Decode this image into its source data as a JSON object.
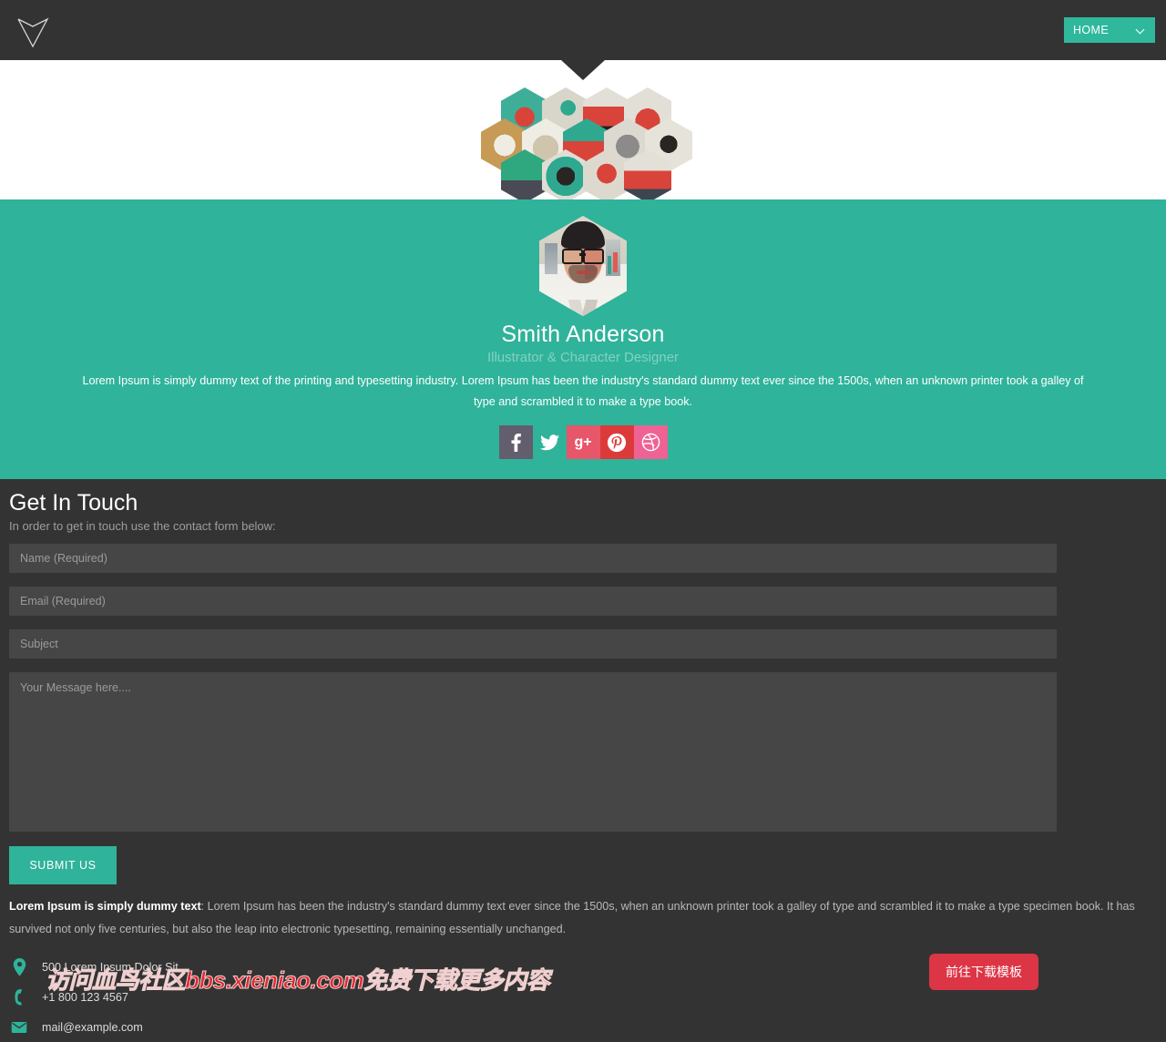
{
  "header": {
    "logo_icon": "chevron-down-logo",
    "nav": {
      "selected": "HOME",
      "options": [
        "HOME"
      ],
      "chevron_icon": "chevron-down-icon",
      "bg_color": "#2fb89c"
    }
  },
  "portfolio": {
    "hexagons": [
      {
        "id": "hex-1",
        "alt": "red character illustration on teal"
      },
      {
        "id": "hex-2",
        "alt": "teal creature illustration on beige"
      },
      {
        "id": "hex-3",
        "alt": "red monster illustration"
      },
      {
        "id": "hex-4",
        "alt": "red warrior illustration"
      },
      {
        "id": "hex-5",
        "alt": "white character on tan background"
      },
      {
        "id": "hex-6",
        "alt": "beige animal illustration"
      },
      {
        "id": "hex-7",
        "alt": "red rider on teal background"
      },
      {
        "id": "hex-8",
        "alt": "grey beast illustration"
      },
      {
        "id": "hex-9",
        "alt": "dark diamond figure illustration"
      },
      {
        "id": "hex-10",
        "alt": "green dotted landscape illustration"
      },
      {
        "id": "hex-11",
        "alt": "teal and red mask illustration"
      },
      {
        "id": "hex-12",
        "alt": "red figure on beige"
      },
      {
        "id": "hex-13",
        "alt": "red demon illustration"
      }
    ]
  },
  "profile": {
    "avatar_alt": "hexagonal portrait of man with glasses and beard",
    "name": "Smith Anderson",
    "role": "Illustrator & Character Designer",
    "bio": "Lorem Ipsum is simply dummy text of the printing and typesetting industry. Lorem Ipsum has been the industry's standard dummy text ever since the 1500s, when an unknown printer took a galley of type and scrambled it to make a type book.",
    "background_color": "#2fb39a",
    "social": [
      {
        "name": "facebook",
        "glyph": "f",
        "color": "#625e6d"
      },
      {
        "name": "twitter",
        "glyph": "",
        "color": "transparent"
      },
      {
        "name": "google-plus",
        "glyph": "g+",
        "color": "#e8566a"
      },
      {
        "name": "pinterest",
        "glyph": "P",
        "color": "#dc3a3a"
      },
      {
        "name": "dribbble",
        "glyph": "",
        "color": "#ef6294"
      }
    ]
  },
  "contact": {
    "title": "Get In Touch",
    "subtitle": "In order to get in touch use the contact form below:",
    "fields": {
      "name_placeholder": "Name (Required)",
      "name_value": "",
      "email_placeholder": "Email (Required)",
      "email_value": "",
      "subject_placeholder": "Subject",
      "subject_value": "",
      "message_placeholder": "Your Message here....",
      "message_value": ""
    },
    "submit_label": "SUBMIT US",
    "submit_color": "#2fb39a"
  },
  "footer": {
    "paragraph_bold": "Lorem Ipsum is simply dummy text",
    "paragraph_rest": ": Lorem Ipsum has been the industry's standard dummy text ever since the 1500s, when an unknown printer took a galley of type and scrambled it to make a type specimen book. It has survived not only five centuries, but also the leap into electronic typesetting, remaining essentially unchanged.",
    "details": [
      {
        "icon": "location-pin-icon",
        "text": "500 Lorem Ipsum Dolor Sit,"
      },
      {
        "icon": "phone-icon",
        "text": "+1 800 123 4567"
      },
      {
        "icon": "envelope-icon",
        "text": "mail@example.com"
      }
    ],
    "download_button": "前往下载模板",
    "download_color": "#dc3545"
  },
  "watermark": {
    "text": "访问血鸟社区bbs.xieniao.com免费下载更多内容",
    "color": "#e02a32"
  }
}
